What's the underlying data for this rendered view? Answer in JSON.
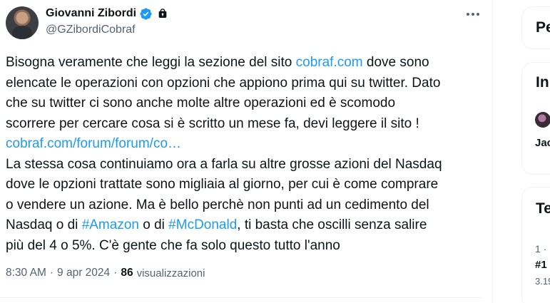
{
  "tweet": {
    "author_name": "Giovanni Zibordi",
    "author_handle": "@GZibordiCobraf",
    "text_lines": [
      [
        {
          "t": "Bisogna veramente che leggi la sezione del sito "
        },
        {
          "t": "cobraf.com",
          "link": true
        },
        {
          "t": " dove sono"
        }
      ],
      [
        {
          "t": "elencate le operazioni con opzioni che appiono prima qui su twitter. Dato"
        }
      ],
      [
        {
          "t": "che su twitter ci sono anche molte altre operazioni ed è scomodo"
        }
      ],
      [
        {
          "t": "scorrere per cercare cosa si è scritto un mese fa, devi leggere il sito !"
        }
      ],
      [
        {
          "t": "cobraf.com/forum/forum/co…",
          "link": true
        }
      ],
      [
        {
          "t": "La stessa cosa continuiamo ora a farla su altre grosse azioni del Nasdaq"
        }
      ],
      [
        {
          "t": "dove le opzioni trattate sono migliaia al giorno, per cui è come comprare"
        }
      ],
      [
        {
          "t": "o vendere un azione. Ma è bello perchè non punti ad un cedimento del"
        }
      ],
      [
        {
          "t": "Nasdaq o di "
        },
        {
          "t": "#Amazon",
          "link": true
        },
        {
          "t": " o di "
        },
        {
          "t": "#McDonald",
          "link": true
        },
        {
          "t": ", ti basta che oscilli senza salire"
        }
      ],
      [
        {
          "t": "più del 4 o 5%. C'è gente che fa solo questo tutto l'anno"
        }
      ]
    ],
    "time": "8:30 AM",
    "date": "9 apr 2024",
    "separator": "·",
    "views_count": "86",
    "views_label": "visualizzazioni"
  },
  "sidebar": {
    "card1_heading": "Pe",
    "card2_heading": "In",
    "card2_user": "Jac",
    "card3_heading": "Te",
    "card3_rank": "1 ·",
    "card3_trend": "#1",
    "card3_count": "3.19"
  },
  "colors": {
    "link": "#1d9bf0",
    "text": "#0f1419",
    "secondary": "#536471",
    "verified": "#1d9bf0"
  },
  "icons": [
    "verified-badge-icon",
    "lock-icon",
    "more-options-icon"
  ]
}
